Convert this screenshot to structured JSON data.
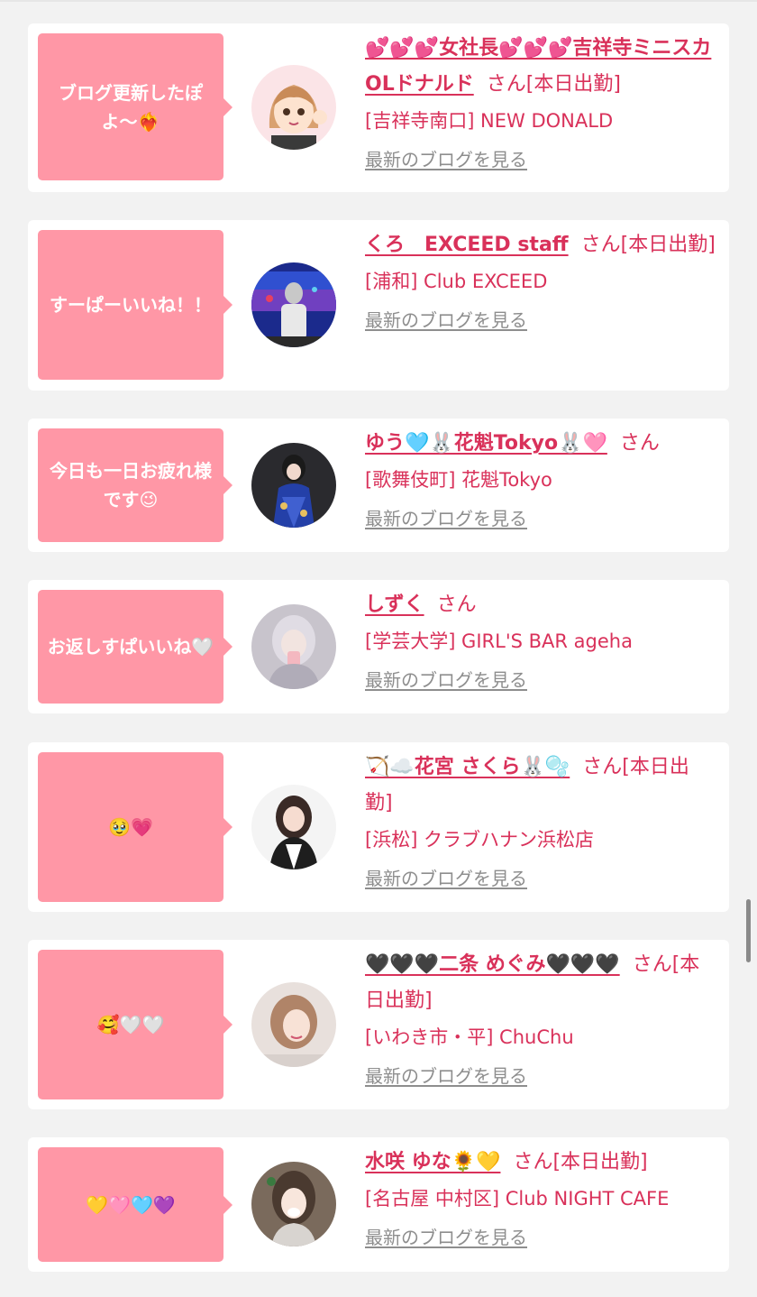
{
  "blog_link_label": "最新のブログを見る",
  "posts": [
    {
      "bubble": "ブログ更新したぽよ〜❤️‍🔥",
      "name": "💕💕💕女社長💕💕💕吉祥寺ミニスカOLドナルド",
      "honorific": "さん",
      "status": "[本日出勤]",
      "shop": "[吉祥寺南口] NEW DONALD",
      "avatar": "anime-girl-avatar"
    },
    {
      "bubble": "すーぱーいいね！！",
      "name": "くろ　EXCEED staff",
      "honorific": "さん",
      "status": "[本日出勤]",
      "shop": "[浦和] Club EXCEED",
      "avatar": "aquarium-photo-avatar"
    },
    {
      "bubble": "今日も一日お疲れ様です😉",
      "name": "ゆう🩵🐰花魁Tokyo🐰🩷",
      "honorific": "さん",
      "status": "",
      "shop": "[歌舞伎町] 花魁Tokyo",
      "avatar": "kimono-photo-avatar"
    },
    {
      "bubble": "お返しすぱいいね🤍",
      "name": "しずく",
      "honorific": "さん",
      "status": "",
      "shop": "[学芸大学] GIRL'S BAR ageha",
      "avatar": "mirror-selfie-avatar"
    },
    {
      "bubble": "🥹💗",
      "name": "🏹☁️花宮 さくら🐰🫧",
      "honorific": "さん",
      "status": "[本日出勤]",
      "shop": "[浜松] クラブハナン浜松店",
      "avatar": "portrait-photo-avatar"
    },
    {
      "bubble": "🥰🤍🤍",
      "name": "🖤🖤🖤二条 めぐみ🖤🖤🖤",
      "honorific": "さん",
      "status": "[本日出勤]",
      "shop": "[いわき市・平] ChuChu",
      "avatar": "selfie-photo-avatar"
    },
    {
      "bubble": "💛🩷🩵💜",
      "name": "水咲 ゆな🌻💛",
      "honorific": "さん",
      "status": "[本日出勤]",
      "shop": "[名古屋 中村区] Club NIGHT CAFE",
      "avatar": "portrait-photo-avatar"
    }
  ],
  "colors": {
    "accent": "#d9315a",
    "bubble": "#ff97a6",
    "link_gray": "#8e8e8e",
    "page_bg": "#f2f2f2"
  }
}
